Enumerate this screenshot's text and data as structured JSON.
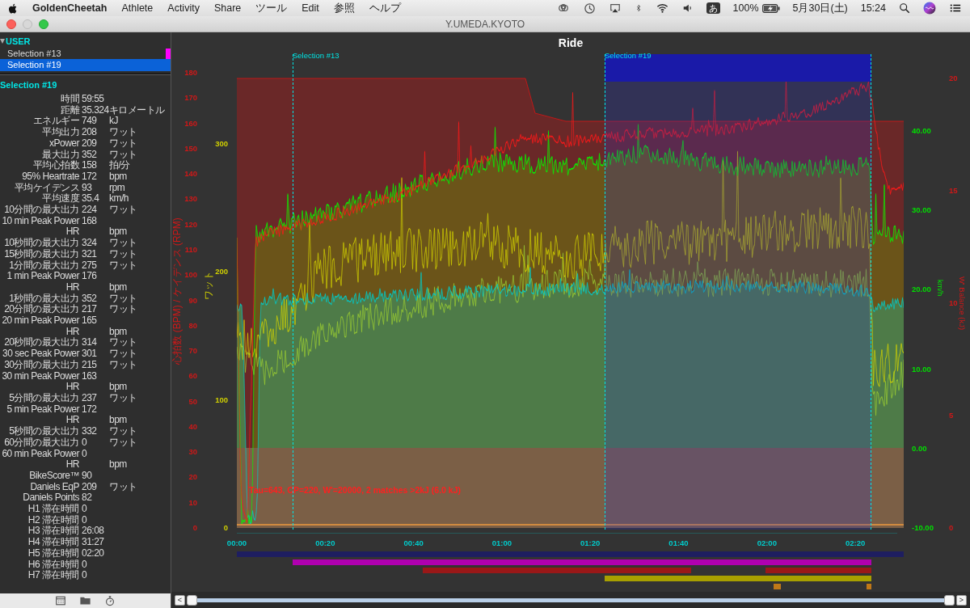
{
  "menu_bar": {
    "app": "GoldenCheetah",
    "items": [
      "Athlete",
      "Activity",
      "Share",
      "ツール",
      "Edit",
      "参照",
      "ヘルプ"
    ],
    "input_method": "あ",
    "battery": "100%",
    "date": "5月30日(土)",
    "time": "15:24"
  },
  "window": {
    "title": "Y.UMEDA.KYOTO"
  },
  "sidebar": {
    "group": {
      "label": "USER",
      "expanded": true,
      "children": [
        {
          "label": "Selection #13",
          "selected": false,
          "color": "#ff00ff"
        },
        {
          "label": "Selection #19",
          "selected": true
        }
      ]
    },
    "summary_title": "Selection #19",
    "metrics": [
      {
        "label": "時間",
        "value": "59:55"
      },
      {
        "label": "距離",
        "value": "35.324キロメートル"
      },
      {
        "label": "エネルギー",
        "value": "749",
        "unit": "kJ"
      },
      {
        "label": "平均出力",
        "value": "208",
        "unit": "ワット"
      },
      {
        "label": "xPower",
        "value": "209",
        "unit": "ワット"
      },
      {
        "label": "最大出力",
        "value": "352",
        "unit": "ワット"
      },
      {
        "label": "平均心拍数",
        "value": "158",
        "unit": "拍/分"
      },
      {
        "label": "95% Heartrate",
        "value": "172",
        "unit": "bpm"
      },
      {
        "label": "平均ケイデンス",
        "value": "93",
        "unit": "rpm"
      },
      {
        "label": "平均速度",
        "value": "35.4",
        "unit": "km/h"
      },
      {
        "label": "10分間の最大出力",
        "value": "224",
        "unit": "ワット"
      },
      {
        "label": "10 min Peak Power HR",
        "value": "168",
        "unit": "bpm"
      },
      {
        "label": "10秒間の最大出力",
        "value": "324",
        "unit": "ワット"
      },
      {
        "label": "15秒間の最大出力",
        "value": "321",
        "unit": "ワット"
      },
      {
        "label": "1分間の最大出力",
        "value": "275",
        "unit": "ワット"
      },
      {
        "label": "1 min Peak Power HR",
        "value": "176",
        "unit": "bpm"
      },
      {
        "label": "1秒間の最大出力",
        "value": "352",
        "unit": "ワット"
      },
      {
        "label": "20分間の最大出力",
        "value": "217",
        "unit": "ワット"
      },
      {
        "label": "20 min Peak Power HR",
        "value": "165",
        "unit": "bpm"
      },
      {
        "label": "20秒間の最大出力",
        "value": "314",
        "unit": "ワット"
      },
      {
        "label": "30 sec Peak Power",
        "value": "301",
        "unit": "ワット"
      },
      {
        "label": "30分間の最大出力",
        "value": "215",
        "unit": "ワット"
      },
      {
        "label": "30 min Peak Power HR",
        "value": "163",
        "unit": "bpm"
      },
      {
        "label": "5分間の最大出力",
        "value": "237",
        "unit": "ワット"
      },
      {
        "label": "5 min Peak Power HR",
        "value": "172",
        "unit": "bpm"
      },
      {
        "label": "5秒間の最大出力",
        "value": "332",
        "unit": "ワット"
      },
      {
        "label": "60分間の最大出力",
        "value": "0",
        "unit": "ワット"
      },
      {
        "label": "60 min Peak Power HR",
        "value": "0",
        "unit": "bpm"
      },
      {
        "label": "BikeScore™",
        "value": "90"
      },
      {
        "label": "Daniels EqP",
        "value": "209",
        "unit": "ワット"
      },
      {
        "label": "Daniels Points",
        "value": "82"
      },
      {
        "label": "H1 滞在時間",
        "value": "0"
      },
      {
        "label": "H2 滞在時間",
        "value": "0"
      },
      {
        "label": "H3 滞在時間",
        "value": "26:08"
      },
      {
        "label": "H4 滞在時間",
        "value": "31:27"
      },
      {
        "label": "H5 滞在時間",
        "value": "02:20"
      },
      {
        "label": "H6 滞在時間",
        "value": "0"
      },
      {
        "label": "H7 滞在時間",
        "value": "0"
      }
    ]
  },
  "chart": {
    "title": "Ride",
    "hr_axis": {
      "title": "心拍数 (BPM) / ケイデンス (RPM)",
      "ticks": [
        "180",
        "170",
        "160",
        "150",
        "140",
        "130",
        "120",
        "110",
        "100",
        "90",
        "80",
        "70",
        "60",
        "50",
        "40",
        "30",
        "20",
        "10",
        "0"
      ]
    },
    "power_axis": {
      "title": "ワット",
      "ticks": [
        "300",
        "200",
        "100",
        "0"
      ]
    },
    "speed_axis": {
      "title": "km/h",
      "ticks": [
        "40.00",
        "30.00",
        "20.00",
        "10.00",
        "0.00",
        "-10.00"
      ]
    },
    "wbal_axis": {
      "title": "W' Balance (kJ)",
      "ticks": [
        "20",
        "15",
        "10",
        "5",
        "0"
      ]
    },
    "x_ticks": [
      "00:00",
      "00:20",
      "00:40",
      "01:00",
      "01:20",
      "01:40",
      "02:00",
      "02:20"
    ],
    "selections": [
      {
        "label": "Selection #13",
        "kind": "marker"
      },
      {
        "label": "Selection #19",
        "kind": "range"
      }
    ],
    "annotation": "Tau=643, CP=220, W'=20000, 2 matches >2kJ (6.0 kJ)"
  },
  "scrollbar": {
    "left": "<",
    "right": ">"
  }
}
